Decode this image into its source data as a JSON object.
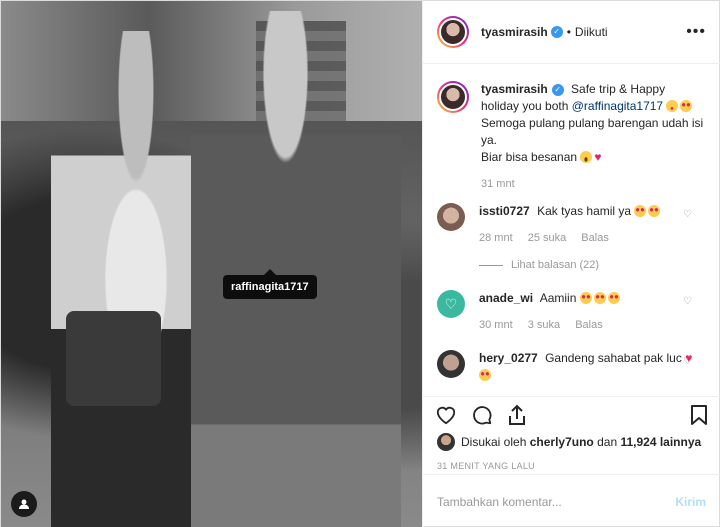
{
  "photo": {
    "tag_label": "raffinagita1717"
  },
  "header": {
    "username": "tyasmirasih",
    "separator": "•",
    "follow_state": "Diikuti",
    "more_label": "•••"
  },
  "caption": {
    "username": "tyasmirasih",
    "text1": "Safe trip & Happy holiday you both",
    "mention": "@raffinagita1717",
    "line2": "Semoga pulang pulang barengan udah isi ya.",
    "line3": "Biar bisa besanan",
    "time": "31 mnt"
  },
  "comments": [
    {
      "username": "issti0727",
      "text": "Kak tyas hamil ya",
      "time": "28 mnt",
      "likes": "25 suka",
      "reply": "Balas",
      "view_replies": "Lihat balasan (22)"
    },
    {
      "username": "anade_wi",
      "text": "Aamiin",
      "time": "30 mnt",
      "likes": "3 suka",
      "reply": "Balas"
    },
    {
      "username": "hery_0277",
      "text": "Gandeng sahabat pak luc"
    }
  ],
  "likes": {
    "prefix": "Disukai oleh",
    "user": "cherly7uno",
    "mid": "dan",
    "count": "11,924 lainnya"
  },
  "timestamp": "31 MENIT YANG LALU",
  "add_comment": {
    "placeholder": "Tambahkan komentar...",
    "post_label": "Kirim"
  },
  "colors": {
    "accent": "#3897f0",
    "post_disabled": "#b2dffc",
    "heart": "#e0245e"
  }
}
